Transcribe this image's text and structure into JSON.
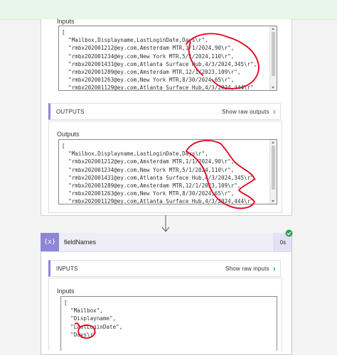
{
  "previous_step": {
    "inputs_label": "Inputs",
    "inputs_lines": [
      "[",
      "  \"Mailbox,Displayname,LastLoginDate,Days\\r\",",
      "  \"rmbx202001212@ey.com,Amsterdam MTR,1/1/2024,90\\r\",",
      "  \"rmbx202001234@ey.com,New York MTR,5/1/2024,110\\r\",",
      "  \"rmbx202001431@ey.com,Atlanta Surface Hub,4/3/2024,345\\r\",",
      "  \"rmbx202001289@ey.com,Amsterdam MTR,12/1/2023,109\\r\",",
      "  \"rmbx202001263@ey.com,New York MTR,8/30/2024,65\\r\",",
      "  \"rmbx202001129@ey.com,Atlanta Surface Hub,4/3/2024,444\\r\""
    ],
    "outputs_header": "OUTPUTS",
    "outputs_show_raw": "Show raw outputs",
    "outputs_label": "Outputs",
    "outputs_lines": [
      "[",
      "  \"Mailbox,Displayname,LastLoginDate,Days\\r\",",
      "  \"rmbx202001212@ey.com,Amsterdam MTR,1/1/2024,90\\r\",",
      "  \"rmbx202001234@ey.com,New York MTR,5/1/2024,110\\r\",",
      "  \"rmbx202001431@ey.com,Atlanta Surface Hub,4/3/2024,345\\r\",",
      "  \"rmbx202001289@ey.com,Amsterdam MTR,12/1/2023,109\\r\",",
      "  \"rmbx202001263@ey.com,New York MTR,8/30/2024,65\\r\",",
      "  \"rmbx202001129@ey.com,Atlanta Surface Hub,4/3/2024,444\\r\""
    ]
  },
  "action": {
    "icon_glyph": "{x}",
    "title": "fieldNames",
    "duration": "0s",
    "inputs_header": "INPUTS",
    "inputs_show_raw": "Show raw inputs",
    "inputs_label": "Inputs",
    "inputs_lines": [
      "[",
      "  \"Mailbox\",",
      "  \"Displayname\",",
      "  \"LastLoginDate\",",
      "  \"Days\\r\""
    ]
  },
  "colors": {
    "accent": "#8f85d8",
    "success": "#31a24c",
    "link": "#0078d4",
    "annotation": "#e3001b"
  },
  "icons": [
    "chevron-right-icon",
    "down-arrow-icon",
    "success-check-icon",
    "variable-icon"
  ]
}
